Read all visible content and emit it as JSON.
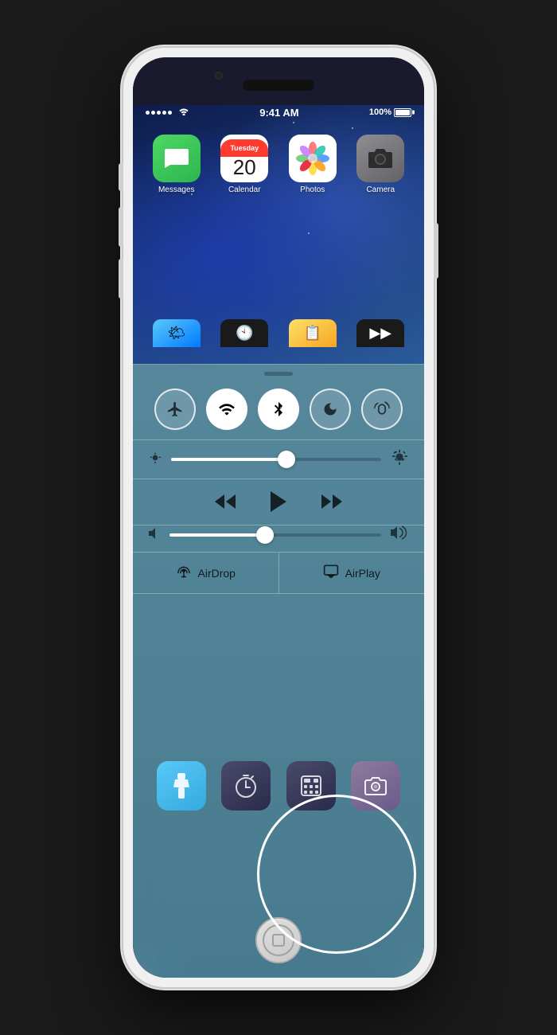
{
  "phone": {
    "status_bar": {
      "time": "9:41 AM",
      "battery_percent": "100%",
      "signal_full": true
    },
    "calendar_day": "Tuesday",
    "calendar_date": "20",
    "app_icons": [
      {
        "label": "Messages",
        "icon": "messages"
      },
      {
        "label": "Calendar",
        "icon": "calendar"
      },
      {
        "label": "Photos",
        "icon": "photos"
      },
      {
        "label": "Camera",
        "icon": "camera"
      }
    ],
    "control_center": {
      "toggles": [
        {
          "name": "airplane-mode",
          "label": "✈",
          "active": false
        },
        {
          "name": "wifi",
          "label": "wifi",
          "active": true
        },
        {
          "name": "bluetooth",
          "label": "bluetooth",
          "active": true
        },
        {
          "name": "do-not-disturb",
          "label": "moon",
          "active": false
        },
        {
          "name": "rotation-lock",
          "label": "rotation",
          "active": false
        }
      ],
      "brightness_value": 55,
      "media_controls": {
        "rewind": "⏮",
        "play": "▶",
        "fast_forward": "⏭"
      },
      "volume_value": 45,
      "airdrop_label": "AirDrop",
      "airplay_label": "AirPlay",
      "quick_apps": [
        {
          "label": "Flashlight",
          "icon": "flashlight"
        },
        {
          "label": "Timer",
          "icon": "timer"
        },
        {
          "label": "Calculator",
          "icon": "calculator"
        },
        {
          "label": "Camera",
          "icon": "camera"
        }
      ]
    }
  }
}
